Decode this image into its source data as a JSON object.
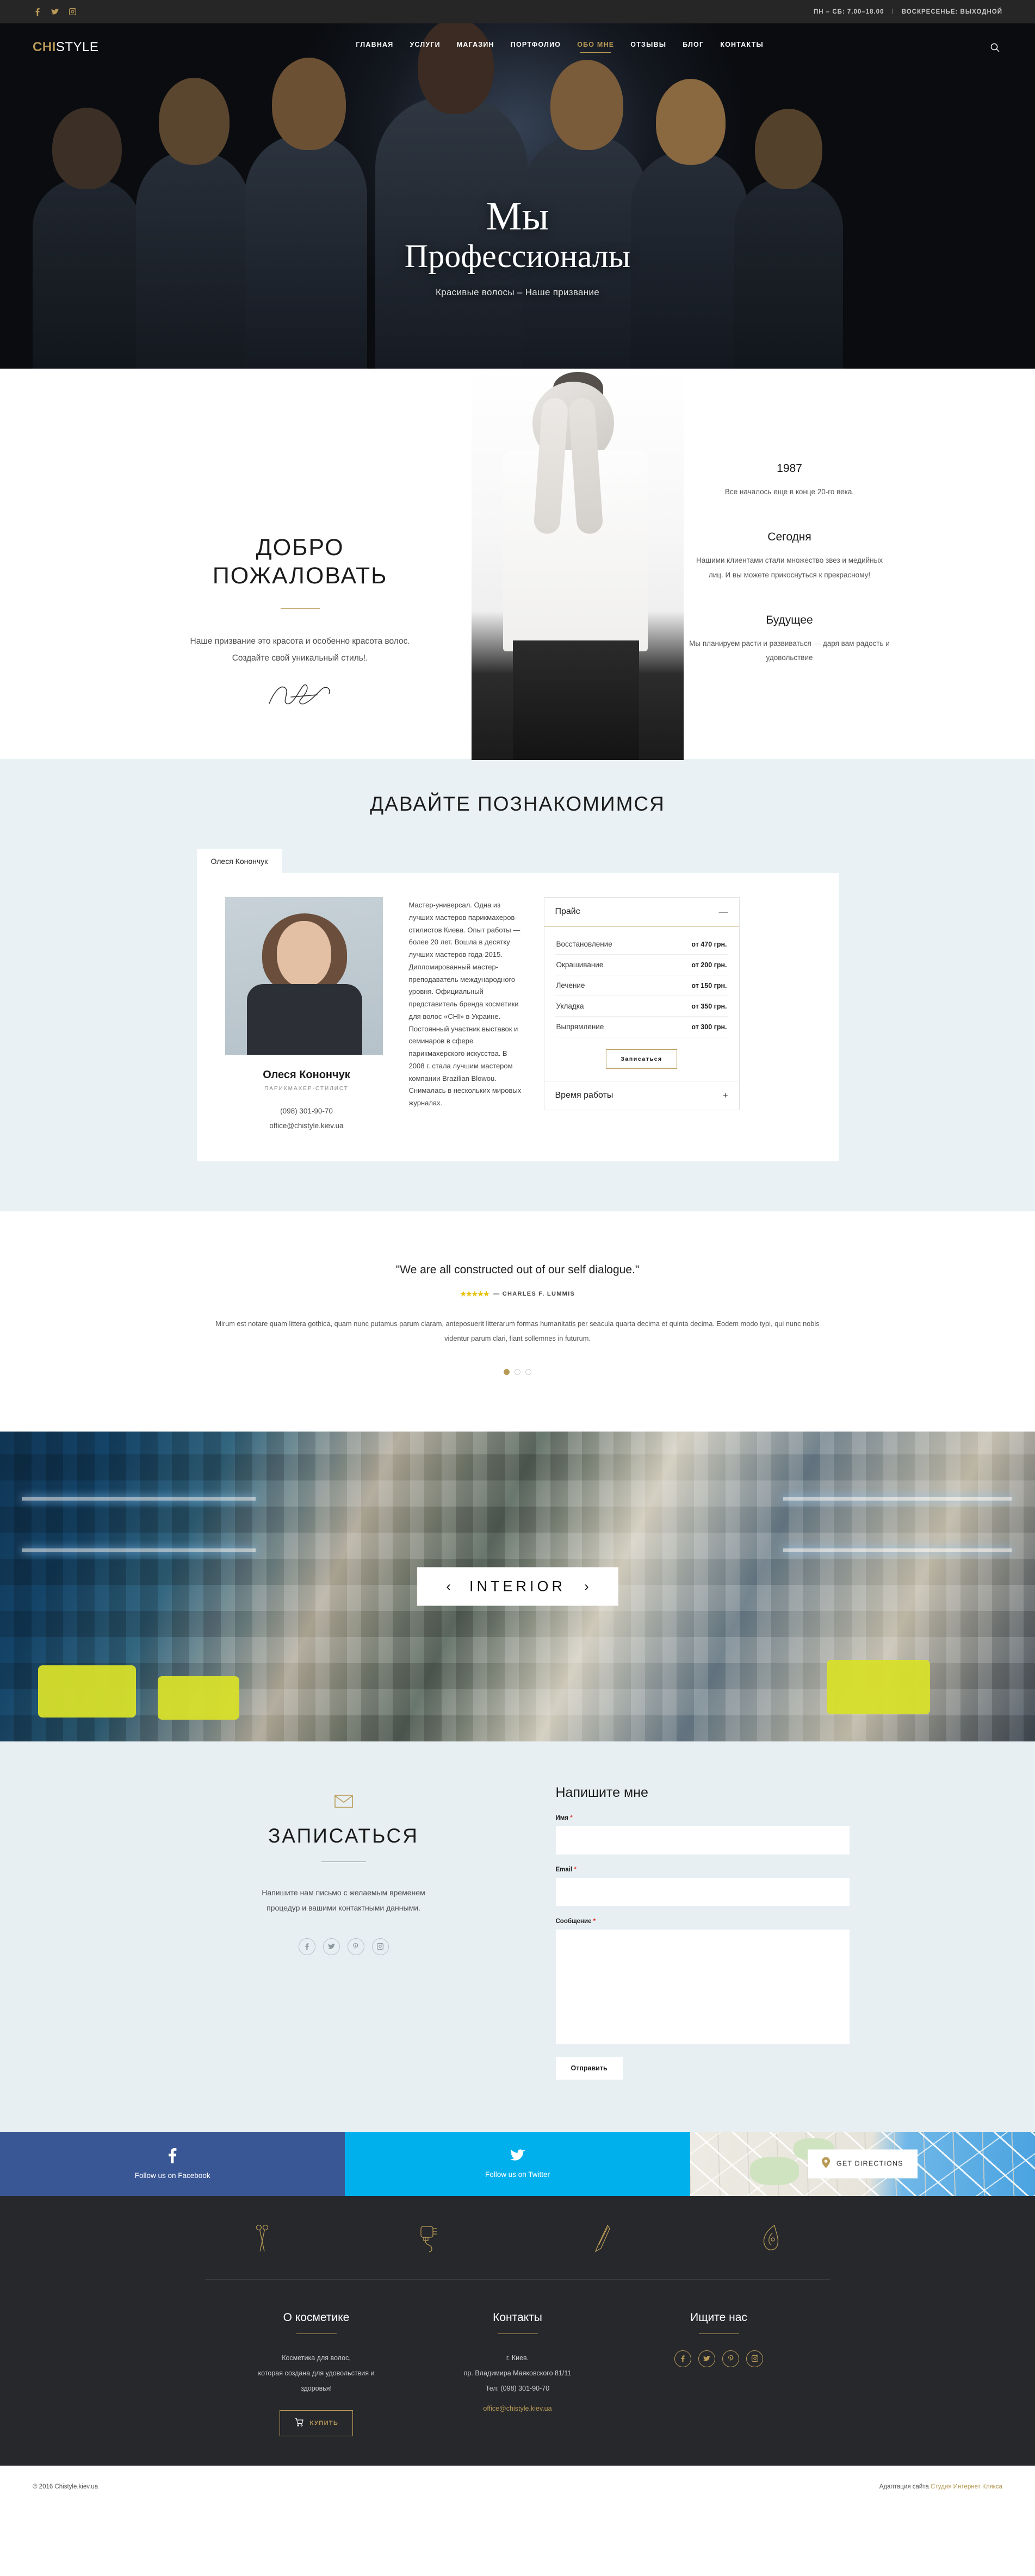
{
  "topbar": {
    "social": [
      {
        "name": "facebook-icon",
        "glyph": "f"
      },
      {
        "name": "twitter-icon",
        "glyph": "ᴠ"
      },
      {
        "name": "instagram-icon",
        "glyph": "▣"
      }
    ],
    "hours_weekday": "ПН – СБ: 7.00–18.00",
    "separator": "/",
    "hours_sunday": "ВОСКРЕСЕНЬЕ: ВЫХОДНОЙ"
  },
  "header": {
    "logo_part1": "CHI",
    "logo_part2": "STYLE",
    "nav": [
      {
        "label": "ГЛАВНАЯ",
        "active": false
      },
      {
        "label": "УСЛУГИ",
        "active": false
      },
      {
        "label": "МАГАЗИН",
        "active": false
      },
      {
        "label": "ПОРТФОЛИО",
        "active": false
      },
      {
        "label": "ОБО МНЕ",
        "active": true
      },
      {
        "label": "ОТЗЫВЫ",
        "active": false
      },
      {
        "label": "БЛОГ",
        "active": false
      },
      {
        "label": "КОНТАКТЫ",
        "active": false
      }
    ],
    "search_label": "Поиск"
  },
  "hero": {
    "title_line1": "Мы",
    "title_line2": "Профессионалы",
    "subtitle": "Красивые волосы – Наше призвание"
  },
  "welcome": {
    "title_line1": "ДОБРО",
    "title_line2": "ПОЖАЛОВАТЬ",
    "text_line1": "Наше призвание это красота и особенно красота волос.",
    "text_line2": "Создайте свой уникальный стиль!.",
    "blocks": [
      {
        "heading": "1987",
        "text": "Все началось еще в конце 20-го века."
      },
      {
        "heading": "Сегодня",
        "text": "Нашими клиентами стали множество звез и медийных лиц. И вы можете прикоснуться к прекрасному!"
      },
      {
        "heading": "Будущее",
        "text": "Мы планируем расти и развиваться — даря вам радость и удовольствие"
      }
    ]
  },
  "meet": {
    "title": "ДАВАЙТЕ ПОЗНАКОМИМСЯ",
    "tab_label": "Олеся Конончук",
    "master": {
      "name": "Олеся Конончук",
      "role": "ПАРИКМАХЕР-СТИЛИСТ",
      "phone": "(098) 301-90-70",
      "email": "office@chistyle.kiev.ua",
      "bio": "Мастер-универсал. Одна из лучших мастеров парикмахеров-стилистов Киева. Опыт работы — более 20 лет. Вошла в десятку лучших мастеров года-2015. Дипломированный мастер-преподаватель международного уровня. Официальный представитель бренда косметики для волос «CHI» в Украине. Постоянный участник выставок и семинаров в сфере парикмахерского искусства. В 2008 г. стала лучшим мастером компании Brazilian Blowou. Снималась в нескольких мировых журналах."
    },
    "accordion": {
      "price_label": "Прайс",
      "price_sign": "—",
      "hours_label": "Время работы",
      "hours_sign": "+",
      "prices": [
        {
          "service": "Восстановление",
          "price": "от 470 грн."
        },
        {
          "service": "Окрашивание",
          "price": "от 200 грн."
        },
        {
          "service": "Лечение",
          "price": "от 150 грн."
        },
        {
          "service": "Укладка",
          "price": "от 350 грн."
        },
        {
          "service": "Выпрямление",
          "price": "от 300 грн."
        }
      ],
      "signup_label": "Записаться"
    }
  },
  "testimonial": {
    "quote": "\"We are all constructed out of our self dialogue.\"",
    "stars": "★★★★★",
    "author": "— CHARLES F. LUMMIS",
    "body": "Mirum est notare quam littera gothica, quam nunc putamus parum claram, anteposuerit litterarum formas humanitatis per seacula quarta decima et quinta decima. Eodem modo typi, qui nunc nobis videntur parum clari, fiant sollemnes in futurum.",
    "dots_total": 3,
    "dot_active": 1
  },
  "interior": {
    "label": "INTERIOR",
    "prev": "‹",
    "next": "›"
  },
  "appointment": {
    "title": "ЗАПИСАТЬСЯ",
    "text_line1": "Напишите нам письмо с желаемым временем",
    "text_line2": "процедур и вашими контактными данными.",
    "social": [
      {
        "name": "facebook-icon",
        "glyph": "f"
      },
      {
        "name": "twitter-icon",
        "glyph": "ᴠ"
      },
      {
        "name": "pinterest-icon",
        "glyph": "Ⓟ"
      },
      {
        "name": "instagram-icon",
        "glyph": "▣"
      }
    ],
    "form": {
      "heading": "Напишите мне",
      "name_label": "Имя",
      "name_value": "",
      "name_placeholder": "",
      "email_label": "Email",
      "email_value": "",
      "email_placeholder": "",
      "message_label": "Сообщение",
      "message_value": "",
      "message_placeholder": "",
      "required_mark": "*",
      "submit_label": "Отправить"
    }
  },
  "strip": {
    "facebook_label": "Follow us on Facebook",
    "facebook_color": "#3a5795",
    "twitter_label": "Follow us on Twitter",
    "twitter_color": "#00b0ed",
    "directions_label": "GET DIRECTIONS"
  },
  "footer": {
    "icons": [
      "scissors-icon",
      "hairdryer-icon",
      "razor-icon",
      "hair-strand-icon"
    ],
    "col1": {
      "heading": "О косметике",
      "line1": "Косметика для волос,",
      "line2": "которая создана для удовольствия и",
      "line3": "здоровья!",
      "buy_label": "КУПИТЬ"
    },
    "col2": {
      "heading": "Контакты",
      "city": "г. Киев.",
      "address": "пр. Владимира Маяковского 81/11",
      "phone": "Тел: (098) 301-90-70",
      "email": "office@chistyle.kiev.ua"
    },
    "col3": {
      "heading": "Ищите нас",
      "social": [
        {
          "name": "facebook-icon",
          "glyph": "f"
        },
        {
          "name": "twitter-icon",
          "glyph": "ᴠ"
        },
        {
          "name": "pinterest-icon",
          "glyph": "Ⓟ"
        },
        {
          "name": "instagram-icon",
          "glyph": "▣"
        }
      ]
    },
    "copyright": "© 2016 Chistyle.kiev.ua",
    "credit_prefix": "Адаптация сайта",
    "credit_link": "Студия Интернет Клякса"
  },
  "colors": {
    "gold": "#b99a56",
    "dark": "#26282c",
    "light_blue": "#eaf1f4",
    "facebook": "#3a5795",
    "twitter": "#00b0ed"
  }
}
